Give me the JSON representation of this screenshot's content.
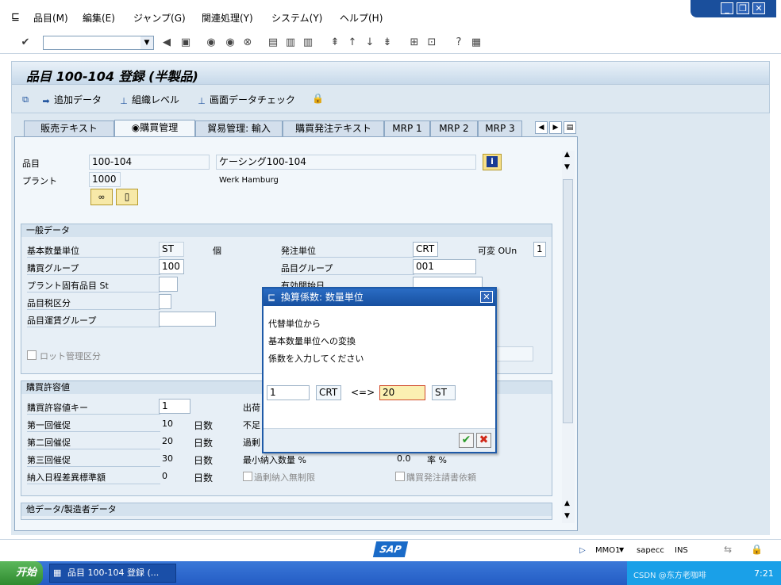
{
  "menu": [
    "品目(M)",
    "編集(E)",
    "ジャンプ(G)",
    "関連処理(Y)",
    "システム(Y)",
    "ヘルプ(H)"
  ],
  "window_controls": [
    "minimize-icon",
    "restore-icon",
    "close-icon"
  ],
  "command_field": {
    "value": ""
  },
  "title": "品目 100-104 登録 (半製品)",
  "app_toolbar": {
    "add_data": "追加データ",
    "org_levels": "組織レベル",
    "screen_check": "画面データチェック"
  },
  "tabs": [
    "販売テキスト",
    "購買管理",
    "貿易管理: 輸入",
    "購買発注テキスト",
    "MRP 1",
    "MRP 2",
    "MRP 3"
  ],
  "active_tab": "購買管理",
  "header": {
    "material_label": "品目",
    "material_value": "100-104",
    "material_desc": "ケーシング100-104",
    "plant_label": "プラント",
    "plant_value": "1000",
    "plant_name": "Werk Hamburg"
  },
  "general": {
    "title": "一般データ",
    "base_uom_label": "基本数量単位",
    "base_uom": "ST",
    "base_uom_text": "個",
    "order_unit_label": "発注単位",
    "order_unit": "CRT",
    "var_oun_label": "可変 OUn",
    "var_oun": "1",
    "purch_group_label": "購買グループ",
    "purch_group": "100",
    "material_group_label": "品目グループ",
    "material_group": "001",
    "plant_status_label": "プラント固有品目 St",
    "valid_from_label": "有効開始日",
    "tax_ind_label": "品目税区分",
    "freight_group_label": "品目運賃グループ",
    "batch_mgmt_label": "ロット管理区分"
  },
  "tolerance": {
    "title": "購買許容値",
    "key_label": "購買許容値キー",
    "key": "1",
    "rem1_label": "第一回催促",
    "rem1": "10",
    "rem2_label": "第二回催促",
    "rem2": "20",
    "rem3_label": "第三回催促",
    "rem3": "30",
    "days": "日数",
    "std_dev_label": "納入日程差異標準額",
    "std_dev": "0",
    "ship_label": "出荷",
    "under_label": "不足",
    "over_label": "過剰",
    "min_qty_label": "最小納入数量 %",
    "min_qty": "0.0",
    "rate": "率 %",
    "unlimited_label": "過剰納入無制限",
    "ack_label": "購買発注請書依頼"
  },
  "other_section": "他データ/製造者データ",
  "dialog": {
    "title": "換算係数: 数量単位",
    "line1": "代替単位から",
    "line2": "基本数量単位への変換",
    "line3": "係数を入力してください",
    "qty1": "1",
    "unit1": "CRT",
    "arrow": "<=>",
    "qty2": "20",
    "unit2": "ST"
  },
  "status": {
    "transaction": "MMO1",
    "system": "sapecc",
    "mode": "INS",
    "logo": "SAP"
  },
  "taskbar": {
    "start": "开始",
    "item": "品目 100-104 登録 (...",
    "clock": "7:21",
    "watermark": "CSDN @东方老咖啡"
  }
}
